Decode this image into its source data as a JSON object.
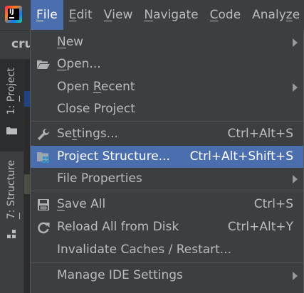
{
  "menubar": {
    "items": [
      {
        "mn": "F",
        "rest": "ile"
      },
      {
        "mn": "E",
        "rest": "dit"
      },
      {
        "mn": "V",
        "rest": "iew"
      },
      {
        "mn": "N",
        "rest": "avigate"
      },
      {
        "mn": "C",
        "rest": "ode"
      },
      {
        "pre": "Analy",
        "mn": "z",
        "rest": "e"
      }
    ]
  },
  "editor": {
    "project_name": "cru"
  },
  "tool_strip": {
    "project": {
      "pre": "1: ",
      "mn": "P",
      "rest": "roject"
    },
    "structure": {
      "mn": "7",
      "rest": ": Structure"
    }
  },
  "file_menu": {
    "new": {
      "mn": "N",
      "rest": "ew"
    },
    "open": {
      "mn": "O",
      "rest": "pen..."
    },
    "open_recent": {
      "pre": "Open ",
      "mn": "R",
      "rest": "ecent"
    },
    "close_project": {
      "label": "Close Project"
    },
    "settings": {
      "pre": "Se",
      "mn": "t",
      "rest": "tings...",
      "shortcut": "Ctrl+Alt+S"
    },
    "project_structure": {
      "label": "Project Structure...",
      "shortcut": "Ctrl+Alt+Shift+S"
    },
    "file_properties": {
      "label": "File Properties"
    },
    "save_all": {
      "mn": "S",
      "rest": "ave All",
      "shortcut": "Ctrl+S"
    },
    "reload_all": {
      "label": "Reload All from Disk",
      "shortcut": "Ctrl+Alt+Y"
    },
    "invalidate_caches": {
      "label": "Invalidate Caches / Restart..."
    },
    "manage_ide_settings": {
      "label": "Manage IDE Settings"
    }
  },
  "colors": {
    "menu_bg": "#3c3f41",
    "highlight": "#4b6eaf",
    "text": "#bbbbbb",
    "text_selected": "#ffffff"
  },
  "icons": {
    "app": "intellij-logo-icon",
    "open": "folder-open-icon",
    "settings": "wrench-icon",
    "project_structure": "project-structure-icon",
    "save_all": "floppy-disk-icon",
    "reload_all": "reload-icon",
    "submenu": "submenu-arrow-icon"
  }
}
